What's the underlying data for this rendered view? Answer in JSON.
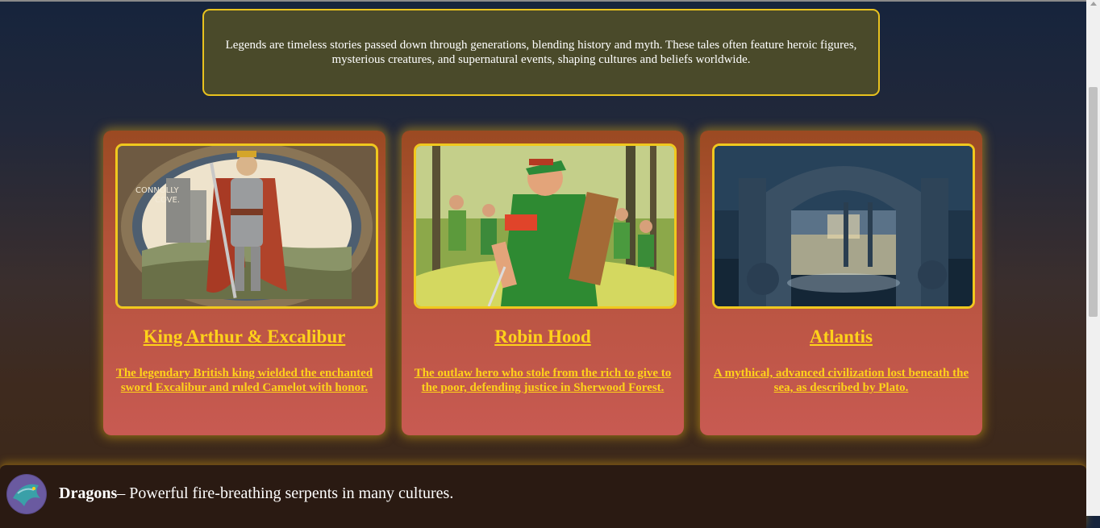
{
  "intro": {
    "text": "Legends are timeless stories passed down through generations, blending history and myth. These tales often feature heroic figures, mysterious creatures, and supernatural events, shaping cultures and beliefs worldwide."
  },
  "cards": [
    {
      "title": "King Arthur & Excalibur",
      "description": "The legendary British king wielded the enchanted sword Excalibur and ruled Camelot with honor.",
      "image_caption": "CONNOLLY\nCOVE."
    },
    {
      "title": "Robin Hood",
      "description": "The outlaw hero who stole from the rich to give to the poor, defending justice in Sherwood Forest."
    },
    {
      "title": "Atlantis",
      "description": "A mythical, advanced civilization lost beneath the sea, as described by Plato."
    }
  ],
  "bottom": {
    "name": "Dragons",
    "text": "– Powerful fire-breathing serpents in many cultures."
  },
  "colors": {
    "accent": "#ffd21a",
    "border": "#f0c81e",
    "intro_bg": "#4a4a2a"
  }
}
